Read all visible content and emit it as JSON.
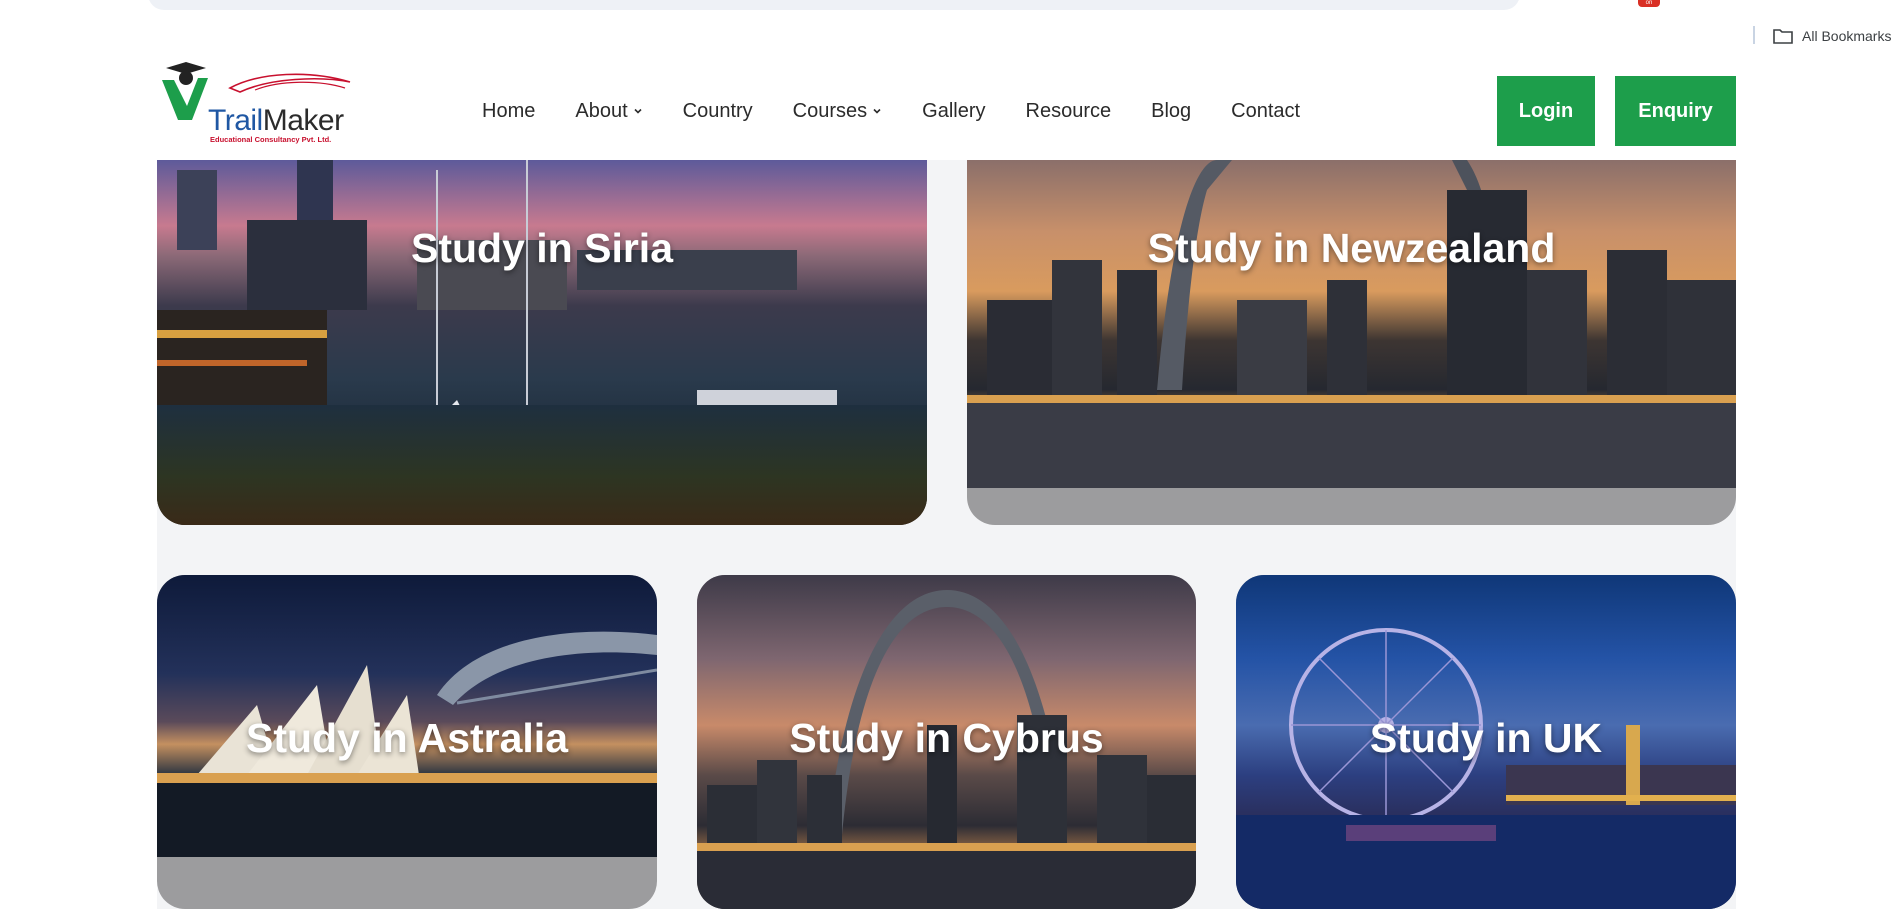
{
  "browser": {
    "bookmarks_label": "All Bookmarks",
    "badge_text": "on"
  },
  "brand": {
    "name_part1": "Trail",
    "name_part2": "Maker",
    "tagline": "Educational Consultancy Pvt. Ltd."
  },
  "nav": {
    "items": [
      {
        "label": "Home",
        "has_dropdown": false
      },
      {
        "label": "About",
        "has_dropdown": true
      },
      {
        "label": "Country",
        "has_dropdown": false
      },
      {
        "label": "Courses",
        "has_dropdown": true
      },
      {
        "label": "Gallery",
        "has_dropdown": false
      },
      {
        "label": "Resource",
        "has_dropdown": false
      },
      {
        "label": "Blog",
        "has_dropdown": false
      },
      {
        "label": "Contact",
        "has_dropdown": false
      }
    ]
  },
  "actions": {
    "login_label": "Login",
    "enquiry_label": "Enquiry",
    "button_color": "#1d9e4b"
  },
  "destinations": {
    "cards": [
      {
        "title": "Study in Siria",
        "image": "harbor-marina-icon"
      },
      {
        "title": "Study in Newzealand",
        "image": "gateway-arch-skyline-icon"
      },
      {
        "title": "Study in Astralia",
        "image": "sydney-opera-house-icon"
      },
      {
        "title": "Study in Cybrus",
        "image": "gateway-arch-skyline-icon"
      },
      {
        "title": "Study in UK",
        "image": "london-eye-icon"
      }
    ]
  }
}
